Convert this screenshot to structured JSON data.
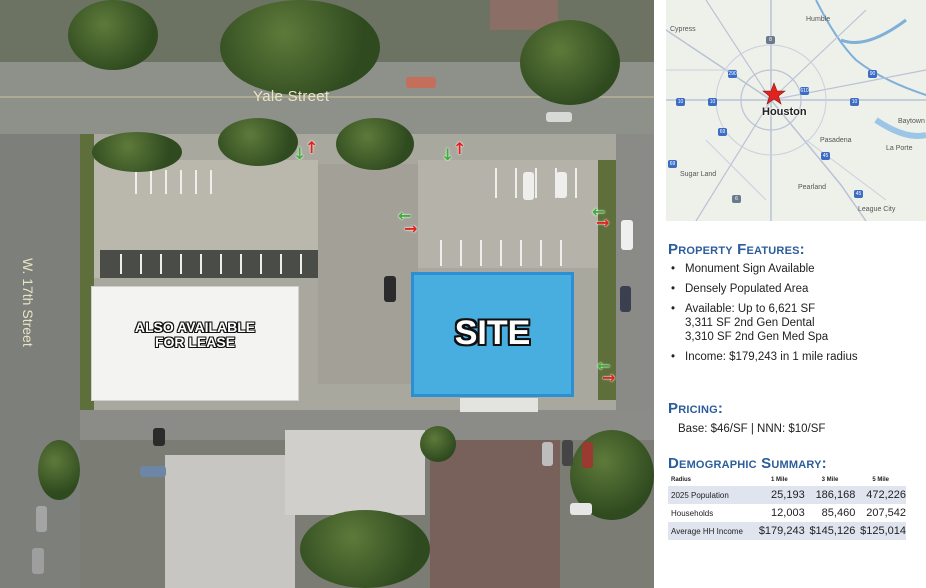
{
  "aerial": {
    "street_yale": "Yale Street",
    "street_17th": "W. 17th Street",
    "lease_label_line1": "ALSO AVAILABLE",
    "lease_label_line2": "FOR LEASE",
    "site_label": "SITE",
    "colors": {
      "site_fill": "#48aee0",
      "site_border": "#2b8fd3",
      "arrow_in": "#3fae3a",
      "arrow_out": "#e0231f"
    }
  },
  "map": {
    "marker_label": "Houston",
    "marker_icon": "red-star-icon",
    "places": [
      "Cypress",
      "Humble",
      "Baytown",
      "Pasadena",
      "La Porte",
      "Sugar Land",
      "Pearland",
      "League City"
    ],
    "shields": [
      "290",
      "90",
      "10",
      "10",
      "610",
      "10",
      "45",
      "69",
      "8",
      "6",
      "45",
      "69"
    ]
  },
  "features": {
    "title": "Property Features:",
    "items": [
      "Monument Sign Available",
      "Densely Populated Area",
      "Available: Up to 6,621 SF",
      "Income: $179,243 in 1 mile radius"
    ],
    "available_sub": [
      "3,311 SF 2nd Gen Dental",
      "3,310 SF 2nd Gen Med Spa"
    ]
  },
  "pricing": {
    "title": "Pricing:",
    "text": "Base: $46/SF | NNN: $10/SF"
  },
  "demographics": {
    "title": "Demographic Summary:",
    "headers": [
      "Radius",
      "1 Mile",
      "3 Mile",
      "5 Mile"
    ],
    "rows": [
      [
        "2025 Population",
        "25,193",
        "186,168",
        "472,226"
      ],
      [
        "Households",
        "12,003",
        "85,460",
        "207,542"
      ],
      [
        "Average HH Income",
        "$179,243",
        "$145,126",
        "$125,014"
      ]
    ]
  }
}
